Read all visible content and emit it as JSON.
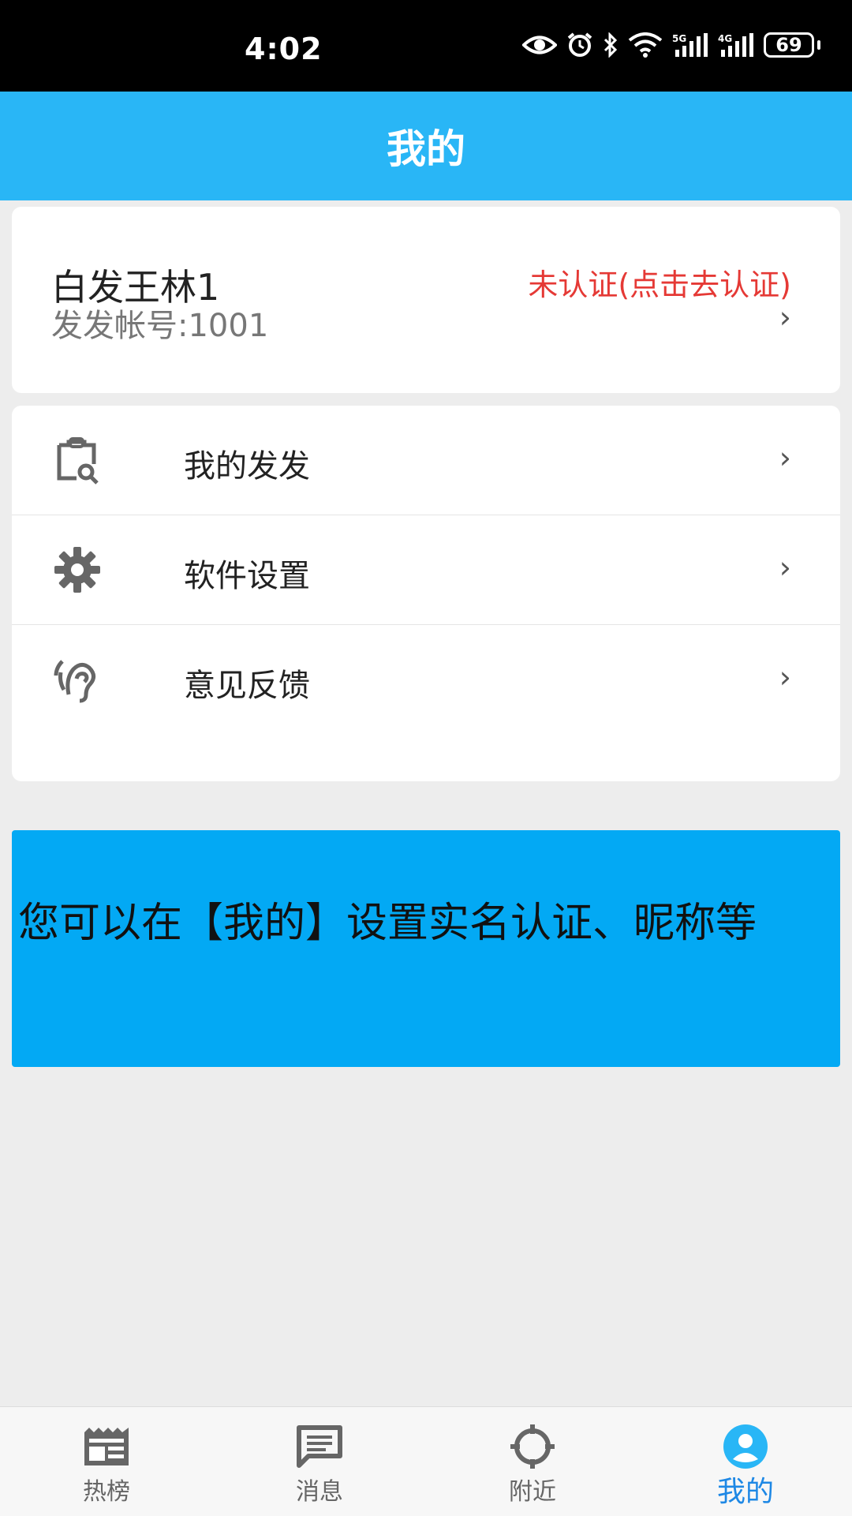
{
  "status_bar": {
    "time": "4:02",
    "battery": "69",
    "icons": [
      "eye-icon",
      "alarm-icon",
      "bluetooth-icon",
      "wifi-icon",
      "signal-5g-icon",
      "signal-4g-icon",
      "battery-icon"
    ]
  },
  "header": {
    "title": "我的"
  },
  "profile": {
    "name": "白发王林1",
    "account": "发发帐号:1001",
    "verify_status": "未认证(点击去认证)",
    "chevron": "›"
  },
  "menu": {
    "items": [
      {
        "label": "我的发发",
        "icon": "clipboard-search-icon"
      },
      {
        "label": "软件设置",
        "icon": "gear-icon"
      },
      {
        "label": "意见反馈",
        "icon": "ear-icon"
      }
    ],
    "chevron": "›"
  },
  "tip": {
    "text": "您可以在【我的】设置实名认证、昵称等"
  },
  "bottom_nav": {
    "items": [
      {
        "label": "热榜",
        "icon": "newspaper-icon"
      },
      {
        "label": "消息",
        "icon": "message-icon"
      },
      {
        "label": "附近",
        "icon": "crosshair-icon"
      },
      {
        "label": "我的",
        "icon": "account-icon"
      }
    ],
    "active": "我的"
  },
  "colors": {
    "header_bg": "#29b6f6",
    "tip_bg": "#03a9f4",
    "verify_text": "#e53935",
    "nav_active": "#1e88e5"
  }
}
